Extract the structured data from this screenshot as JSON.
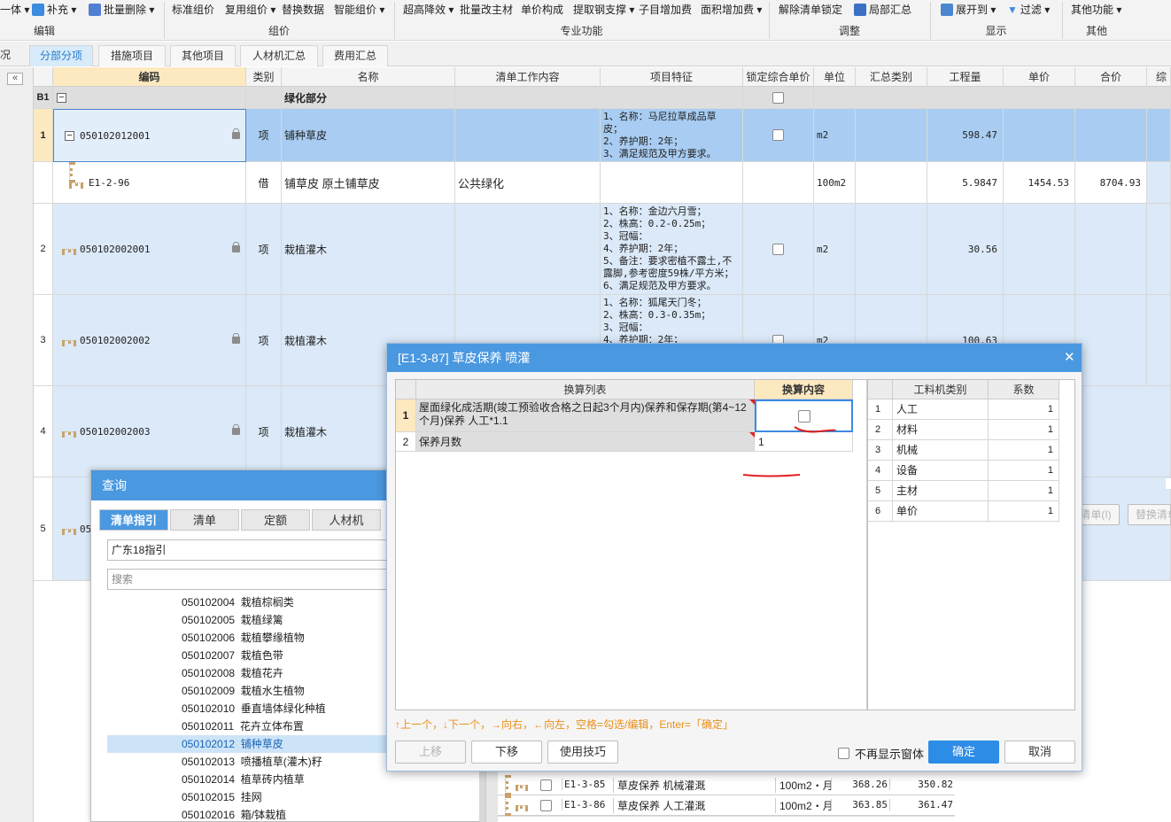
{
  "ribbon": {
    "buttons": {
      "integrate": "一体",
      "supplement": "补充",
      "batch_delete": "批量删除",
      "std_price": "标准组价",
      "reuse_price": "复用组价",
      "replace_data": "替换数据",
      "smart_price": "智能组价",
      "super_height": "超高降效",
      "batch_main_mat": "批量改主材",
      "unit_price_comp": "单价构成",
      "extract_steel": "提取钢支撑",
      "sub_item_add": "子目增加费",
      "area_add": "面积增加费",
      "unlock_list": "解除清单锁定",
      "partial_summary": "局部汇总",
      "expand_to": "展开到",
      "filter": "过滤",
      "other_func": "其他功能"
    },
    "groups": {
      "edit": "编辑",
      "price": "组价",
      "professional": "专业功能",
      "adjust": "调整",
      "display": "显示",
      "other": "其他"
    }
  },
  "tabs": {
    "overview": "况",
    "items": [
      "分部分项",
      "措施项目",
      "其他项目",
      "人材机汇总",
      "费用汇总"
    ]
  },
  "grid": {
    "headers": [
      "编码",
      "类别",
      "名称",
      "清单工作内容",
      "项目特征",
      "锁定综合单价",
      "单位",
      "汇总类别",
      "工程量",
      "单价",
      "合价",
      "综"
    ],
    "section": {
      "label": "B1",
      "name": "绿化部分"
    },
    "rows": [
      {
        "no": "1",
        "code": "050102012001",
        "type": "项",
        "name": "铺种草皮",
        "work": "",
        "feature": "1、名称：马尼拉草成品草\n皮；\n2、养护期：2年；\n3、满足规范及甲方要求。",
        "unit": "m2",
        "qty": "598.47",
        "price": "",
        "total": ""
      },
      {
        "no": "",
        "code": "E1-2-96",
        "type": "借",
        "name": "铺草皮 原土铺草皮",
        "work": "公共绿化",
        "feature": "",
        "unit": "100m2",
        "qty": "5.9847",
        "price": "1454.53",
        "total": "8704.93"
      },
      {
        "no": "2",
        "code": "050102002001",
        "type": "项",
        "name": "栽植灌木",
        "work": "",
        "feature": "1、名称：金边六月雪；\n2、株高：0.2-0.25m；\n3、冠幅：\n4、养护期：2年；\n5、备注：要求密植不露土,不\n露脚,参考密度59株/平方米；\n6、满足规范及甲方要求。",
        "unit": "m2",
        "qty": "30.56",
        "price": "",
        "total": ""
      },
      {
        "no": "3",
        "code": "050102002002",
        "type": "项",
        "name": "栽植灌木",
        "work": "",
        "feature": "1、名称：狐尾天门冬；\n2、株高：0.3-0.35m；\n3、冠幅：\n4、养护期：2年；",
        "unit": "m2",
        "qty": "100.63",
        "price": "",
        "total": ""
      },
      {
        "no": "4",
        "code": "050102002003",
        "type": "项",
        "name": "栽植灌木",
        "work": "",
        "feature": "",
        "unit": "",
        "qty": "",
        "price": "",
        "total": ""
      },
      {
        "no": "5",
        "code": "05",
        "type": "",
        "name": "",
        "work": "",
        "feature": "",
        "unit": "",
        "qty": "",
        "price": "",
        "total": ""
      }
    ]
  },
  "query": {
    "title": "查询",
    "tabs": [
      "清单指引",
      "清单",
      "定额",
      "人材机"
    ],
    "region": "广东18指引",
    "search_placeholder": "搜索",
    "items": [
      {
        "code": "050102004",
        "name": "栽植棕榈类"
      },
      {
        "code": "050102005",
        "name": "栽植绿篱"
      },
      {
        "code": "050102006",
        "name": "栽植攀缘植物"
      },
      {
        "code": "050102007",
        "name": "栽植色带"
      },
      {
        "code": "050102008",
        "name": "栽植花卉"
      },
      {
        "code": "050102009",
        "name": "栽植水生植物"
      },
      {
        "code": "050102010",
        "name": "垂直墙体绿化种植"
      },
      {
        "code": "050102011",
        "name": "花卉立体布置"
      },
      {
        "code": "050102012",
        "name": "铺种草皮"
      },
      {
        "code": "050102013",
        "name": "喷播植草(灌木)籽"
      },
      {
        "code": "050102014",
        "name": "植草砖内植草"
      },
      {
        "code": "050102015",
        "name": "挂网"
      },
      {
        "code": "050102016",
        "name": "箱/钵栽植"
      }
    ]
  },
  "right_partial": {
    "btn1": "清单(I)",
    "btn2": "替换清单"
  },
  "bottom_table": {
    "rows": [
      {
        "code": "E1-3-85",
        "name": "草皮保养 机械灌溉",
        "unit": "100m2・月",
        "v1": "368.26",
        "v2": "350.82"
      },
      {
        "code": "E1-3-86",
        "name": "草皮保养 人工灌溉",
        "unit": "100m2・月",
        "v1": "363.85",
        "v2": "361.47"
      }
    ]
  },
  "dialog": {
    "title": "[E1-3-87] 草皮保养 喷灌",
    "left_headers": [
      "换算列表",
      "换算内容"
    ],
    "left_rows": [
      {
        "no": "1",
        "text": "屋面绿化成活期(竣工预验收合格之日起3个月内)保养和保存期(第4~12个月)保养 人工*1.1",
        "value": ""
      },
      {
        "no": "2",
        "text": "保养月数",
        "value": "1"
      }
    ],
    "right_headers": [
      "工料机类别",
      "系数"
    ],
    "right_rows": [
      {
        "no": "1",
        "cat": "人工",
        "coef": "1"
      },
      {
        "no": "2",
        "cat": "材料",
        "coef": "1"
      },
      {
        "no": "3",
        "cat": "机械",
        "coef": "1"
      },
      {
        "no": "4",
        "cat": "设备",
        "coef": "1"
      },
      {
        "no": "5",
        "cat": "主材",
        "coef": "1"
      },
      {
        "no": "6",
        "cat": "单价",
        "coef": "1"
      }
    ],
    "hint": "↑上一个，↓下一个，→向右，←向左，空格=勾选/编辑，Enter=「确定」",
    "buttons": {
      "up": "上移",
      "down": "下移",
      "tips": "使用技巧",
      "ok": "确定",
      "cancel": "取消"
    },
    "no_show_label": "不再显示窗体"
  },
  "colors": {
    "accent": "#4a98e0",
    "selected_row": "#a9cdf2",
    "row_blue": "#dbe9f8",
    "code_header": "#fde9c0",
    "annotation": "#e02020"
  }
}
